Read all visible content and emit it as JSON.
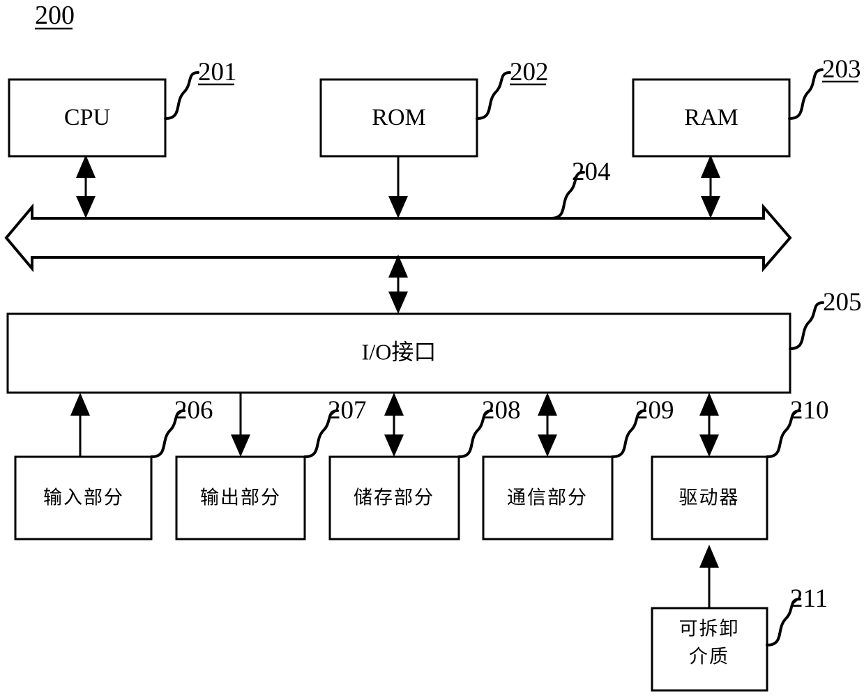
{
  "figure": {
    "title": "200",
    "title_underlined": true
  },
  "boxes": {
    "cpu": {
      "label": "CPU",
      "ref": "201",
      "ref_underlined": true
    },
    "rom": {
      "label": "ROM",
      "ref": "202",
      "ref_underlined": true
    },
    "ram": {
      "label": "RAM",
      "ref": "203",
      "ref_underlined": true
    },
    "bus": {
      "ref": "204",
      "ref_underlined": false
    },
    "io_interface": {
      "label": "I/O接口",
      "ref": "205",
      "ref_underlined": false
    },
    "input_part": {
      "label": "输入部分",
      "ref": "206",
      "ref_underlined": false
    },
    "output_part": {
      "label": "输出部分",
      "ref": "207",
      "ref_underlined": false
    },
    "storage_part": {
      "label": "储存部分",
      "ref": "208",
      "ref_underlined": false
    },
    "communication_part": {
      "label": "通信部分",
      "ref": "209",
      "ref_underlined": false
    },
    "driver": {
      "label": "驱动器",
      "ref": "210",
      "ref_underlined": false
    },
    "removable_media": {
      "label_line1": "可拆卸",
      "label_line2": "介质",
      "ref": "211",
      "ref_underlined": false
    }
  },
  "connections": [
    {
      "from": "cpu",
      "to": "bus",
      "direction": "bidirectional"
    },
    {
      "from": "rom",
      "to": "bus",
      "direction": "down"
    },
    {
      "from": "ram",
      "to": "bus",
      "direction": "bidirectional"
    },
    {
      "from": "bus",
      "to": "io_interface",
      "direction": "bidirectional"
    },
    {
      "from": "input_part",
      "to": "io_interface",
      "direction": "up"
    },
    {
      "from": "io_interface",
      "to": "output_part",
      "direction": "down"
    },
    {
      "from": "storage_part",
      "to": "io_interface",
      "direction": "bidirectional"
    },
    {
      "from": "communication_part",
      "to": "io_interface",
      "direction": "bidirectional"
    },
    {
      "from": "driver",
      "to": "io_interface",
      "direction": "bidirectional"
    },
    {
      "from": "removable_media",
      "to": "driver",
      "direction": "up"
    }
  ],
  "colors": {
    "stroke": "#000000",
    "fill": "#ffffff",
    "text": "#000000"
  }
}
